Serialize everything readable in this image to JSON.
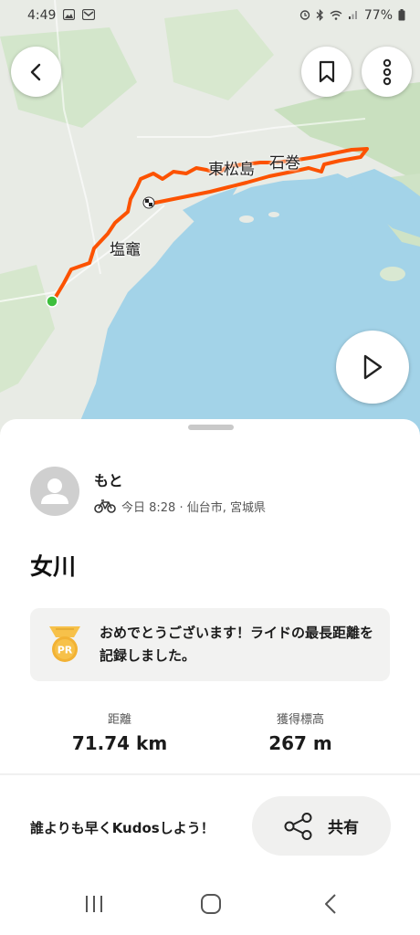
{
  "status_bar": {
    "time": "4:49",
    "battery": "77%",
    "left_icons": [
      "photo-icon",
      "mail-icon"
    ],
    "right_icons": [
      "alarm-icon",
      "bluetooth-icon",
      "wifi-icon",
      "signal-icon",
      "battery-icon"
    ]
  },
  "map": {
    "labels": [
      "東松島",
      "石巻",
      "塩竈"
    ],
    "route_color": "#fc5200",
    "start_color": "#3dbf3d",
    "water_color": "#9fd1e6",
    "land_color": "#e9ebe6",
    "forest_color": "#c8e0bf"
  },
  "toolbar": {
    "back_icon": "back-arrow-icon",
    "bookmark_icon": "bookmark-icon",
    "more_icon": "more-vertical-icon",
    "play_icon": "play-icon"
  },
  "athlete": {
    "name": "もと",
    "activity_icon": "bike-icon",
    "meta": "今日 8:28 · 仙台市, 宮城県"
  },
  "activity": {
    "title": "女川"
  },
  "achievement": {
    "badge": "PR",
    "text": "おめでとうございます！ライドの最長距離を記録しました。"
  },
  "stats": [
    {
      "label": "距離",
      "value": "71.74 km"
    },
    {
      "label": "獲得標高",
      "value": "267 m"
    }
  ],
  "footer": {
    "kudos_prompt": "誰よりも早くKudosしよう！",
    "share_label": "共有",
    "share_icon": "share-icon"
  },
  "navbar": {
    "recent_icon": "recent-apps-icon",
    "home_icon": "home-icon",
    "back_icon": "nav-back-icon"
  }
}
